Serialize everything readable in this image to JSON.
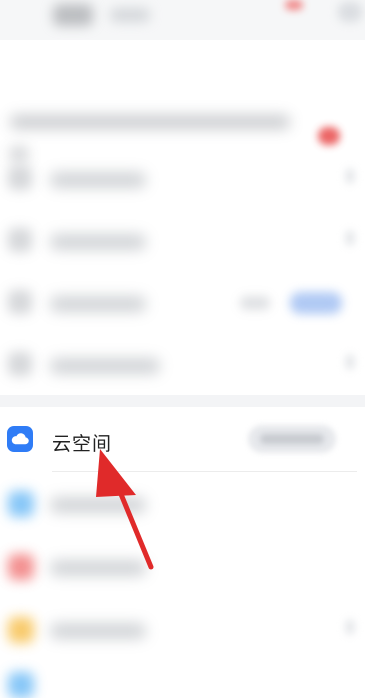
{
  "cloud_space": {
    "label": "云空间",
    "icon": "cloud-icon",
    "icon_color": "#2f7cf6"
  },
  "annotation": {
    "arrow_color": "#e02a2a"
  }
}
